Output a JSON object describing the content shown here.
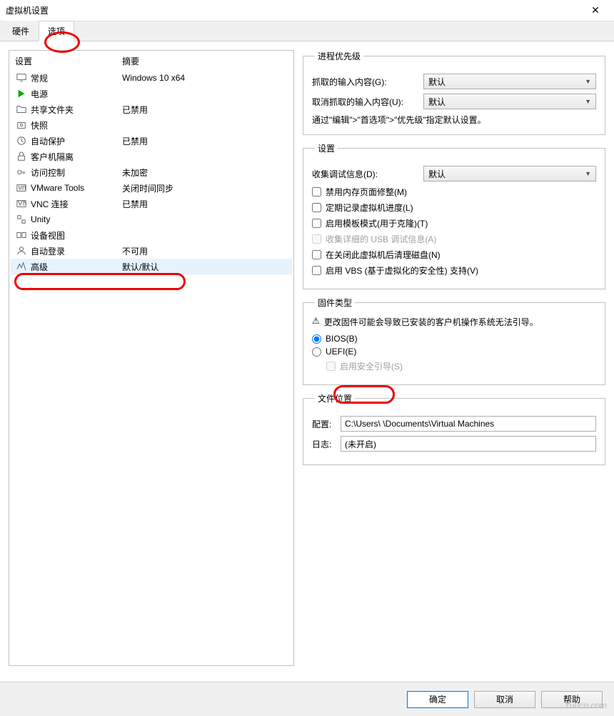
{
  "window": {
    "title": "虚拟机设置"
  },
  "tabs": {
    "hardware": "硬件",
    "options": "选项"
  },
  "leftHeader": {
    "setting": "设置",
    "summary": "摘要"
  },
  "leftRows": [
    {
      "icon": "monitor",
      "name": "常规",
      "summary": "Windows 10 x64"
    },
    {
      "icon": "play",
      "name": "电源",
      "summary": ""
    },
    {
      "icon": "folder",
      "name": "共享文件夹",
      "summary": "已禁用"
    },
    {
      "icon": "camera",
      "name": "快照",
      "summary": ""
    },
    {
      "icon": "clock",
      "name": "自动保护",
      "summary": "已禁用"
    },
    {
      "icon": "lock",
      "name": "客户机隔离",
      "summary": ""
    },
    {
      "icon": "key",
      "name": "访问控制",
      "summary": "未加密"
    },
    {
      "icon": "vm",
      "name": "VMware Tools",
      "summary": "关闭时间同步"
    },
    {
      "icon": "vnc",
      "name": "VNC 连接",
      "summary": "已禁用"
    },
    {
      "icon": "unity",
      "name": "Unity",
      "summary": ""
    },
    {
      "icon": "device",
      "name": "设备视图",
      "summary": ""
    },
    {
      "icon": "auto",
      "name": "自动登录",
      "summary": "不可用"
    },
    {
      "icon": "adv",
      "name": "高级",
      "summary": "默认/默认"
    }
  ],
  "priority": {
    "legend": "进程优先级",
    "grabbed": "抓取的输入内容(G):",
    "ungrabbed": "取消抓取的输入内容(U):",
    "value": "默认",
    "note": "通过\"编辑\">\"首选项\">\"优先级\"指定默认设置。"
  },
  "settings": {
    "legend": "设置",
    "debug": "收集调试信息(D):",
    "debugValue": "默认",
    "cb1": "禁用内存页面修整(M)",
    "cb2": "定期记录虚拟机进度(L)",
    "cb3": "启用模板模式(用于克隆)(T)",
    "cb4": "收集详细的 USB 调试信息(A)",
    "cb5": "在关闭此虚拟机后清理磁盘(N)",
    "cb6": "启用 VBS (基于虚拟化的安全性) 支持(V)"
  },
  "firmware": {
    "legend": "固件类型",
    "warning": "更改固件可能会导致已安装的客户机操作系统无法引导。",
    "bios": "BIOS(B)",
    "uefi": "UEFI(E)",
    "secureBoot": "启用安全引导(S)"
  },
  "fileLocation": {
    "legend": "文件位置",
    "config": "配置:",
    "configPath": "C:\\Users\\        \\Documents\\Virtual Machines",
    "log": "日志:",
    "logPath": "(未开启)"
  },
  "buttons": {
    "ok": "确定",
    "cancel": "取消",
    "help": "帮助"
  },
  "watermark": "Yuucn.com"
}
